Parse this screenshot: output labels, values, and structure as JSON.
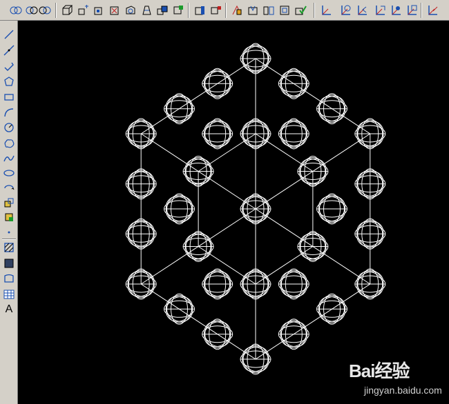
{
  "top_toolbar": {
    "buttons": [
      {
        "icon": "union-icon"
      },
      {
        "icon": "subtract-icon"
      },
      {
        "icon": "intersect-icon"
      },
      {
        "icon": "extrude-faces-icon"
      },
      {
        "icon": "move-faces-icon"
      },
      {
        "icon": "offset-faces-icon"
      },
      {
        "icon": "delete-faces-icon"
      },
      {
        "icon": "rotate-faces-icon"
      },
      {
        "icon": "taper-faces-icon"
      },
      {
        "icon": "copy-faces-icon"
      },
      {
        "icon": "color-faces-icon"
      },
      {
        "icon": "copy-edges-icon"
      },
      {
        "icon": "color-edges-icon"
      },
      {
        "icon": "imprint-icon"
      },
      {
        "icon": "clean-icon"
      },
      {
        "icon": "separate-icon"
      },
      {
        "icon": "shell-icon"
      },
      {
        "icon": "check-icon"
      },
      {
        "icon": "ucs-icon"
      },
      {
        "icon": "ucs-world-icon"
      },
      {
        "icon": "ucs-previous-icon"
      },
      {
        "icon": "ucs-face-icon"
      },
      {
        "icon": "ucs-object-icon"
      },
      {
        "icon": "ucs-view-icon"
      },
      {
        "icon": "ucs-origin-icon"
      }
    ]
  },
  "left_toolbar": {
    "tools": [
      {
        "icon": "line-icon"
      },
      {
        "icon": "construction-line-icon"
      },
      {
        "icon": "polyline-icon"
      },
      {
        "icon": "polygon-icon"
      },
      {
        "icon": "rectangle-icon"
      },
      {
        "icon": "arc-icon"
      },
      {
        "icon": "circle-icon"
      },
      {
        "icon": "revision-cloud-icon"
      },
      {
        "icon": "spline-icon"
      },
      {
        "icon": "ellipse-icon"
      },
      {
        "icon": "ellipse-arc-icon"
      },
      {
        "icon": "insert-block-icon"
      },
      {
        "icon": "make-block-icon"
      },
      {
        "icon": "point-icon"
      },
      {
        "icon": "hatch-icon"
      },
      {
        "icon": "gradient-icon"
      },
      {
        "icon": "region-icon"
      },
      {
        "icon": "table-icon"
      },
      {
        "icon": "multiline-text-icon",
        "label": "A"
      }
    ]
  },
  "canvas": {
    "background": "#000000",
    "line_color": "#ffffff"
  },
  "watermark": {
    "brand": "Bai经验",
    "url": "jingyan.baidu.com"
  }
}
